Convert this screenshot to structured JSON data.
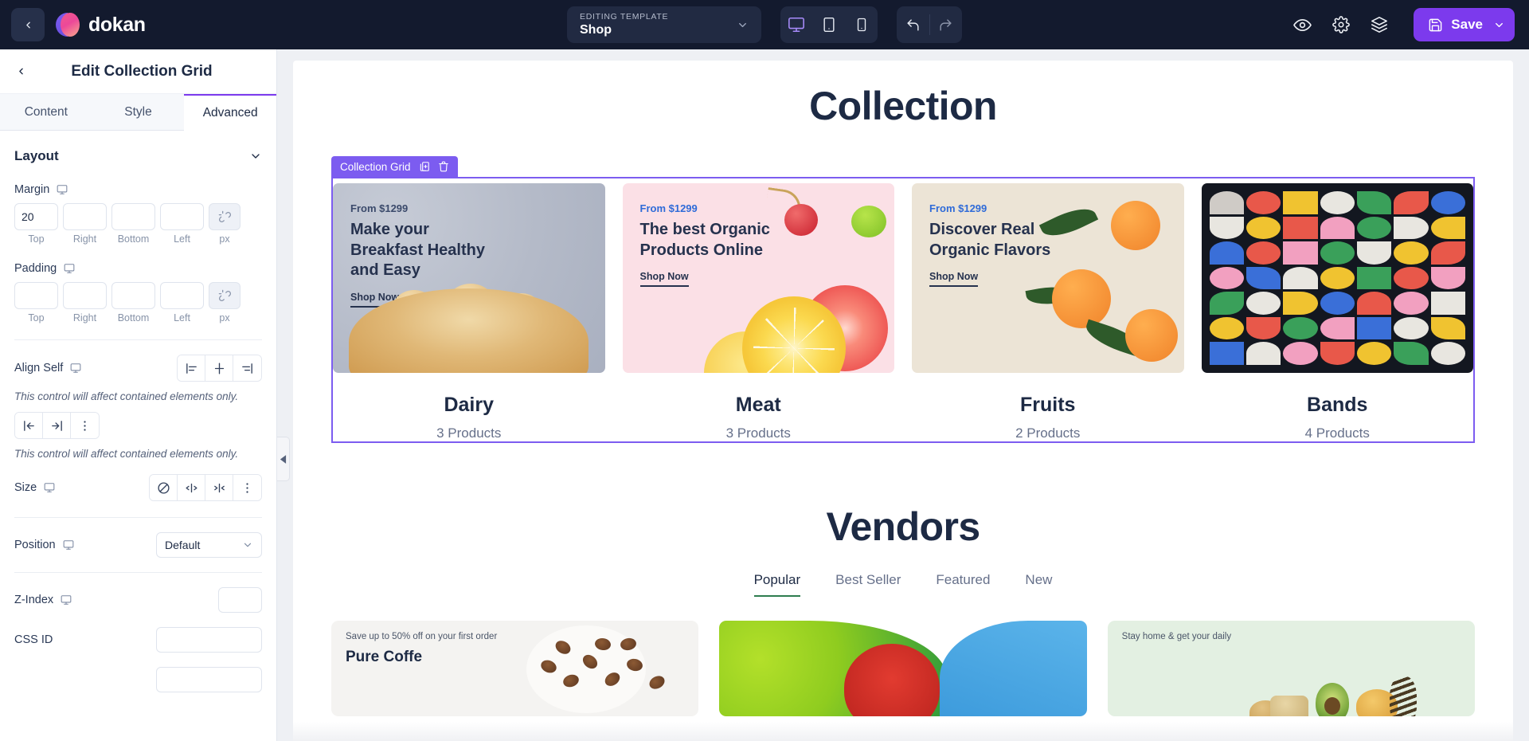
{
  "topbar": {
    "back_icon": "chevron-left-icon",
    "brand": "dokan",
    "template": {
      "label": "EDITING TEMPLATE",
      "value": "Shop",
      "caret": "chevron-down-icon"
    },
    "devices": [
      {
        "name": "desktop",
        "icon": "monitor-icon",
        "active": true
      },
      {
        "name": "tablet",
        "icon": "tablet-icon",
        "active": false
      },
      {
        "name": "mobile",
        "icon": "mobile-icon",
        "active": false
      }
    ],
    "history": [
      {
        "name": "undo",
        "icon": "undo-icon"
      },
      {
        "name": "redo",
        "icon": "redo-icon"
      }
    ],
    "right_icons": [
      {
        "name": "preview",
        "icon": "eye-icon"
      },
      {
        "name": "settings",
        "icon": "gear-icon"
      },
      {
        "name": "layers",
        "icon": "layers-icon"
      }
    ],
    "save": {
      "label": "Save",
      "icon": "save-disk-icon",
      "caret": "chevron-down-icon",
      "color": "#7c3aed"
    }
  },
  "panel": {
    "back_icon": "chevron-left-icon",
    "title": "Edit Collection Grid",
    "tabs": [
      {
        "label": "Content",
        "active": false
      },
      {
        "label": "Style",
        "active": false
      },
      {
        "label": "Advanced",
        "active": true
      }
    ],
    "layout_section": {
      "title": "Layout",
      "collapse_icon": "chevron-down-icon",
      "margin": {
        "label": "Margin",
        "device_icon": "monitor-icon",
        "values": [
          "20",
          "",
          "",
          ""
        ],
        "captions": [
          "Top",
          "Right",
          "Bottom",
          "Left"
        ],
        "unit": "px",
        "link_icon": "link-off-icon"
      },
      "padding": {
        "label": "Padding",
        "device_icon": "monitor-icon",
        "values": [
          "",
          "",
          "",
          ""
        ],
        "captions": [
          "Top",
          "Right",
          "Bottom",
          "Left"
        ],
        "unit": "px",
        "link_icon": "link-off-icon"
      },
      "align_self": {
        "label": "Align Self",
        "device_icon": "monitor-icon",
        "options": [
          "align-start-icon",
          "align-center-icon",
          "align-end-icon"
        ],
        "hint": "This control will affect contained elements only."
      },
      "justify_self": {
        "options": [
          "justify-start-icon",
          "justify-end-icon",
          "more-vertical-icon"
        ],
        "hint": "This control will affect contained elements only."
      },
      "size": {
        "label": "Size",
        "device_icon": "monitor-icon",
        "options": [
          "none-icon",
          "expand-icon",
          "shrink-icon",
          "more-vertical-icon"
        ]
      },
      "position": {
        "label": "Position",
        "device_icon": "monitor-icon",
        "value": "Default",
        "caret": "chevron-down-icon"
      },
      "z_index": {
        "label": "Z-Index",
        "device_icon": "monitor-icon",
        "value": ""
      },
      "css_id": {
        "label": "CSS ID",
        "value": ""
      }
    },
    "collapse_handle_icon": "triangle-left-icon"
  },
  "canvas": {
    "collection": {
      "heading": "Collection",
      "selection_badge": {
        "label": "Collection Grid",
        "duplicate_icon": "duplicate-icon",
        "delete_icon": "trash-icon",
        "color": "#7c5cf0"
      },
      "cards": [
        {
          "price": "From $1299",
          "price_color": "#3b4a6b",
          "title": "Make your Breakfast Healthy and Easy",
          "cta": "Shop Now",
          "name": "Dairy",
          "count": "3 Products"
        },
        {
          "price": "From $1299",
          "price_color": "#2f6bd8",
          "title": "The best Organic Products Online",
          "cta": "Shop Now",
          "name": "Meat",
          "count": "3 Products"
        },
        {
          "price": "From $1299",
          "price_color": "#2f6bd8",
          "title": "Discover Real Organic Flavors",
          "cta": "Shop Now",
          "name": "Fruits",
          "count": "2 Products"
        },
        {
          "price": "",
          "price_color": "#ffffff",
          "title": "",
          "cta": "",
          "name": "Bands",
          "count": "4 Products"
        }
      ]
    },
    "vendors": {
      "heading": "Vendors",
      "tabs": [
        {
          "label": "Popular",
          "active": true
        },
        {
          "label": "Best Seller",
          "active": false
        },
        {
          "label": "Featured",
          "active": false
        },
        {
          "label": "New",
          "active": false
        }
      ],
      "cards": [
        {
          "note": "Save up to 50% off on your first order",
          "title": "Pure Coffe"
        },
        {
          "note": "",
          "title": ""
        },
        {
          "note": "Stay home & get your daily",
          "title": ""
        }
      ]
    }
  }
}
